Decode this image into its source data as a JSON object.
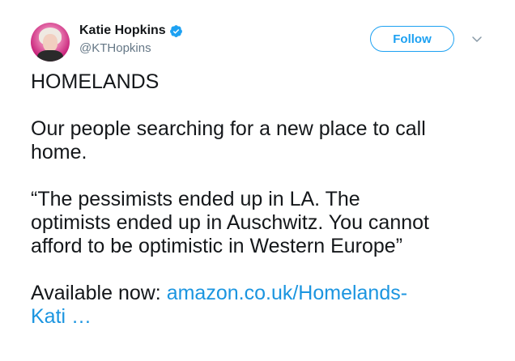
{
  "author": {
    "display_name": "Katie Hopkins",
    "handle": "@KTHopkins",
    "verified": true
  },
  "follow_button_label": "Follow",
  "tweet": {
    "paragraph_1": "HOMELANDS",
    "paragraph_2": "Our people searching for a new place to call\nhome.",
    "paragraph_3": "“The pessimists ended up in LA. The\noptimists ended up in Auschwitz. You cannot\nafford to be optimistic in Western Europe”",
    "available_prefix": "Available now:  ",
    "link_text": "amazon.co.uk/Homelands-\nKati …"
  },
  "colors": {
    "accent": "#1da1f2",
    "link": "#1b95e0",
    "text": "#14171a",
    "secondary_text": "#657786",
    "avatar_background": "#c8237b"
  },
  "icons": {
    "verified": "verified-badge-icon",
    "caret": "chevron-down-icon"
  }
}
